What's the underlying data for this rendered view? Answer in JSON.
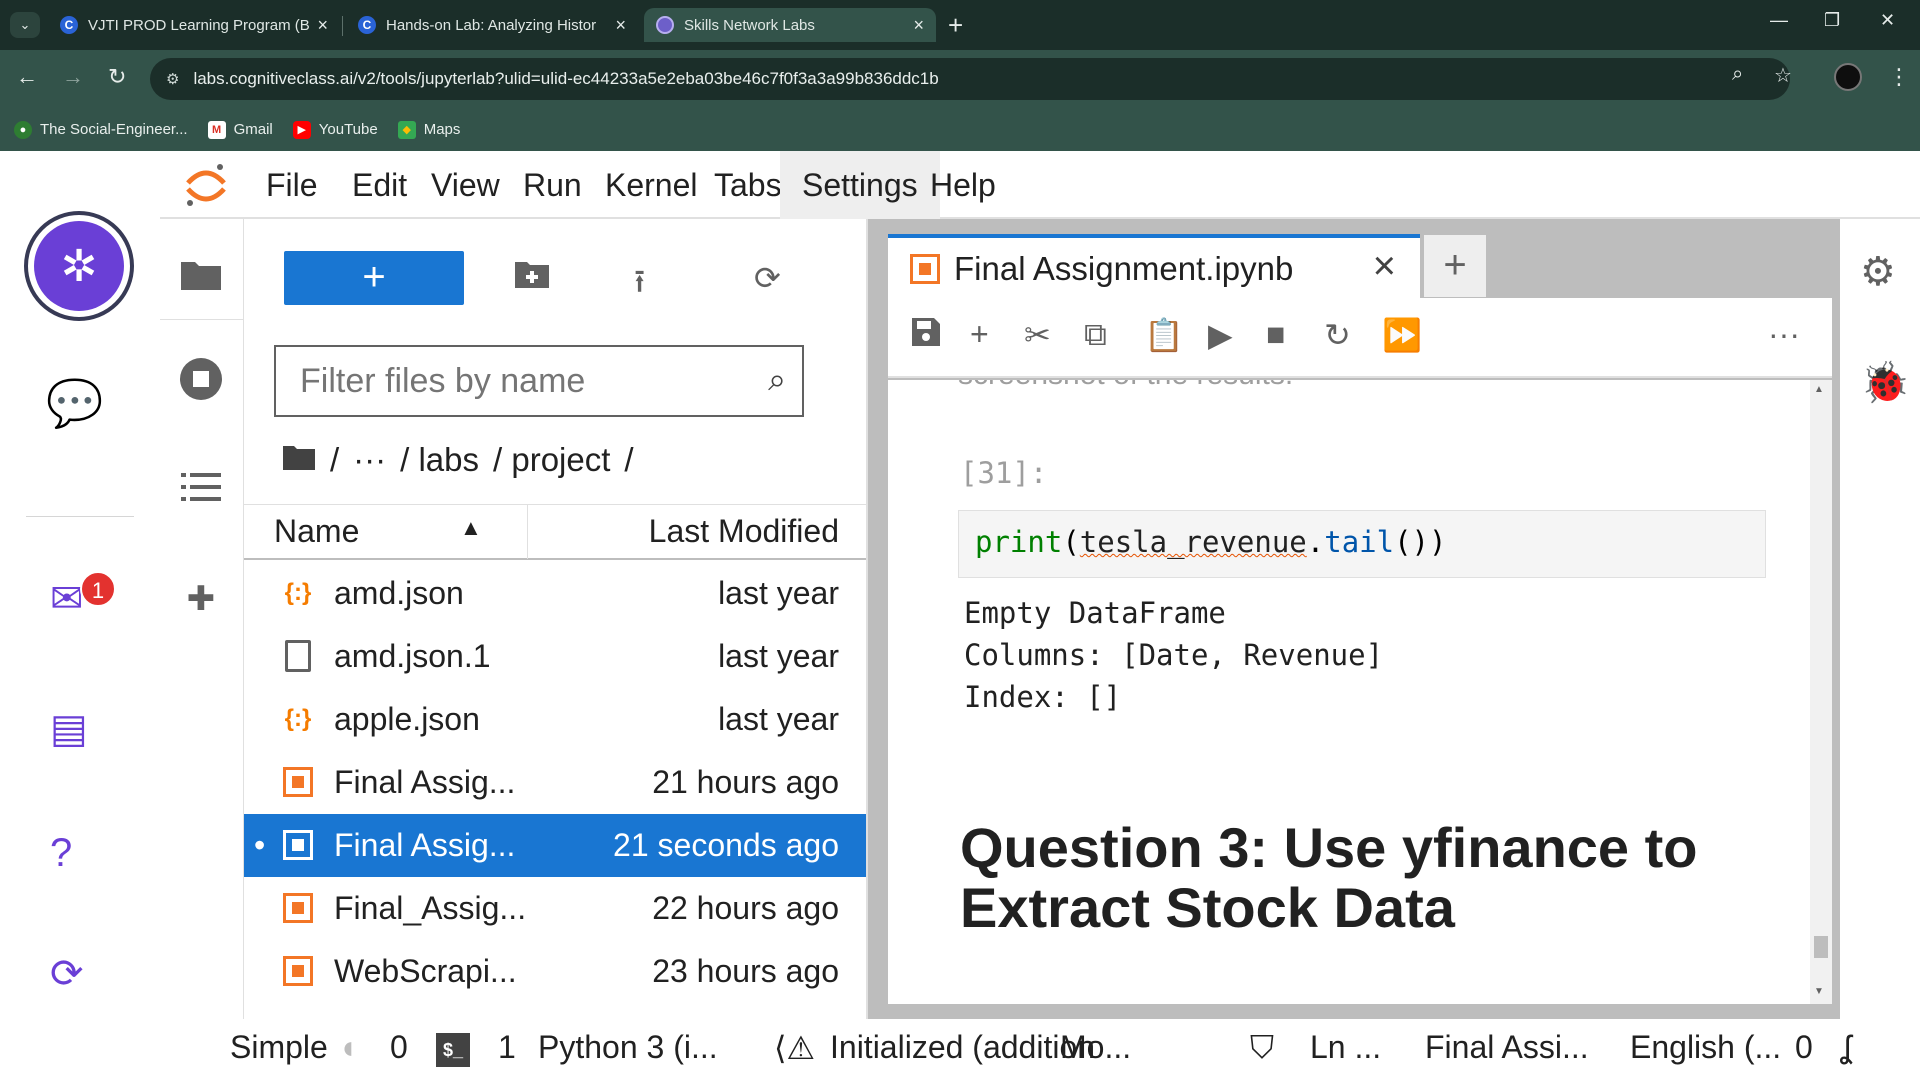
{
  "browser": {
    "tabs": [
      {
        "title": "VJTI PROD Learning Program (B",
        "close": "×"
      },
      {
        "title": "Hands-on Lab: Analyzing Histor",
        "close": "×"
      },
      {
        "title": "Skills Network Labs",
        "close": "×"
      }
    ],
    "new_tab": "+",
    "url": "labs.cognitiveclass.ai/v2/tools/jupyterlab?ulid=ulid-ec44233a5e2eba03be46c7f0f3a3a99b836ddc1b",
    "bookmarks": [
      {
        "label": "The Social-Engineer..."
      },
      {
        "label": "Gmail"
      },
      {
        "label": "YouTube"
      },
      {
        "label": "Maps"
      }
    ]
  },
  "sidebar": {
    "notification_count": "1"
  },
  "menu": [
    "File",
    "Edit",
    "View",
    "Run",
    "Kernel",
    "Tabs",
    "Settings",
    "Help"
  ],
  "filebrowser": {
    "new_label": "+",
    "filter_placeholder": "Filter files by name",
    "crumbs": [
      "/",
      "···",
      "/ labs",
      "/ project",
      "/"
    ],
    "header": {
      "name": "Name",
      "modified": "Last Modified"
    },
    "files": [
      {
        "name": "amd.json",
        "modified": "last year",
        "type": "json"
      },
      {
        "name": "amd.json.1",
        "modified": "last year",
        "type": "file"
      },
      {
        "name": "apple.json",
        "modified": "last year",
        "type": "json"
      },
      {
        "name": "Final Assig...",
        "modified": "21 hours ago",
        "type": "notebook"
      },
      {
        "name": "Final Assig...",
        "modified": "21 seconds ago",
        "type": "notebook",
        "selected": true
      },
      {
        "name": "Final_Assig...",
        "modified": "22 hours ago",
        "type": "notebook"
      },
      {
        "name": "WebScrapi...",
        "modified": "23 hours ago",
        "type": "notebook"
      }
    ]
  },
  "notebook": {
    "tab_title": "Final Assignment.ipynb",
    "cut_text": "screenshot of the results.",
    "prompt": "[31]:",
    "code": {
      "fn": "print",
      "open": "(",
      "obj": "tesla_revenue",
      "dot": ".",
      "method": "tail",
      "close": "())"
    },
    "output": [
      "Empty DataFrame",
      "Columns: [Date, Revenue]",
      "Index: []"
    ],
    "heading": "Question 3: Use yfinance to Extract Stock Data"
  },
  "statusbar": {
    "mode": "Simple",
    "terminals": "0",
    "kernels": "1",
    "kernel_name": "Python 3 (i...",
    "lsp": "Initialized (addition",
    "mode_short": "Mo...",
    "ln": "Ln ...",
    "file": "Final Assi...",
    "lang": "English (...",
    "notifications": "0"
  }
}
